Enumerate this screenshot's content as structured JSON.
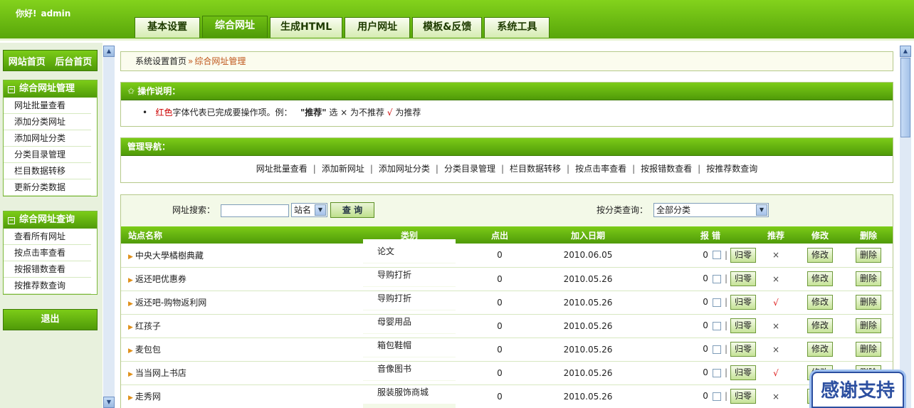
{
  "header": {
    "greeting": "你好!",
    "username": "admin",
    "tabs": [
      "基本设置",
      "综合网址",
      "生成HTML",
      "用户网址",
      "模板&反馈",
      "系统工具"
    ],
    "active_tab": 1
  },
  "sidebar": {
    "top_links": [
      "网站首页",
      "后台首页"
    ],
    "group1": {
      "title": "综合网址管理",
      "items": [
        "网址批量查看",
        "添加分类网址",
        "添加网址分类",
        "分类目录管理",
        "栏目数据转移",
        "更新分类数据"
      ]
    },
    "group2": {
      "title": "综合网址查询",
      "items": [
        "查看所有网址",
        "按点击率查看",
        "按报错数查看",
        "按推荐数查询"
      ]
    },
    "logout": "退出"
  },
  "breadcrumb": {
    "root": "系统设置首页",
    "sep": "»",
    "current": "综合网址管理"
  },
  "ops": {
    "title": "✩ 操作说明：",
    "red_word": "红色",
    "text1": "字体代表已完成要操作项。例：",
    "bold_word": "\"推荐\"",
    "text2": "选 × 为不推荐",
    "tick": "√",
    "text3": "为推荐"
  },
  "nav_panel": {
    "title": "管理导航：",
    "links": [
      "网址批量查看",
      "添加新网址",
      "添加网址分类",
      "分类目录管理",
      "栏目数据转移",
      "按点击率查看",
      "按报错数查看",
      "按推荐数查询"
    ]
  },
  "search": {
    "label": "网址搜索：",
    "field_value": "",
    "field_select": "站名",
    "button": "查 询",
    "category_label": "按分类查询：",
    "category_select": "全部分类"
  },
  "table": {
    "headers": [
      "站点名称",
      "类别",
      "点出",
      "加入日期",
      "报 错",
      "推荐",
      "修改",
      "删除"
    ],
    "reset_label": "归零",
    "edit_label": "修改",
    "delete_label": "删除",
    "rows": [
      {
        "name": "中央大學橘樹典藏",
        "category": "论文",
        "clicks": "0",
        "date": "2010.06.05",
        "errors": "0",
        "recommend": "×"
      },
      {
        "name": "返还吧优惠券",
        "category": "导购打折",
        "clicks": "0",
        "date": "2010.05.26",
        "errors": "0",
        "recommend": "×"
      },
      {
        "name": "返还吧-购物返利网",
        "category": "导购打折",
        "clicks": "0",
        "date": "2010.05.26",
        "errors": "0",
        "recommend": "√"
      },
      {
        "name": "红孩子",
        "category": "母婴用品",
        "clicks": "0",
        "date": "2010.05.26",
        "errors": "0",
        "recommend": "×"
      },
      {
        "name": "麦包包",
        "category": "箱包鞋帽",
        "clicks": "0",
        "date": "2010.05.26",
        "errors": "0",
        "recommend": "×"
      },
      {
        "name": "当当网上书店",
        "category": "音像图书",
        "clicks": "0",
        "date": "2010.05.26",
        "errors": "0",
        "recommend": "√"
      },
      {
        "name": "走秀网",
        "category": "服装服饰商城",
        "clicks": "0",
        "date": "2010.05.26",
        "errors": "0",
        "recommend": "×"
      }
    ]
  },
  "thanks_badge": "感谢支持",
  "colors": {
    "primary_green": "#58a60a",
    "light_green": "#83d21c",
    "accent_orange": "#c0581e",
    "red": "#cc0000"
  }
}
